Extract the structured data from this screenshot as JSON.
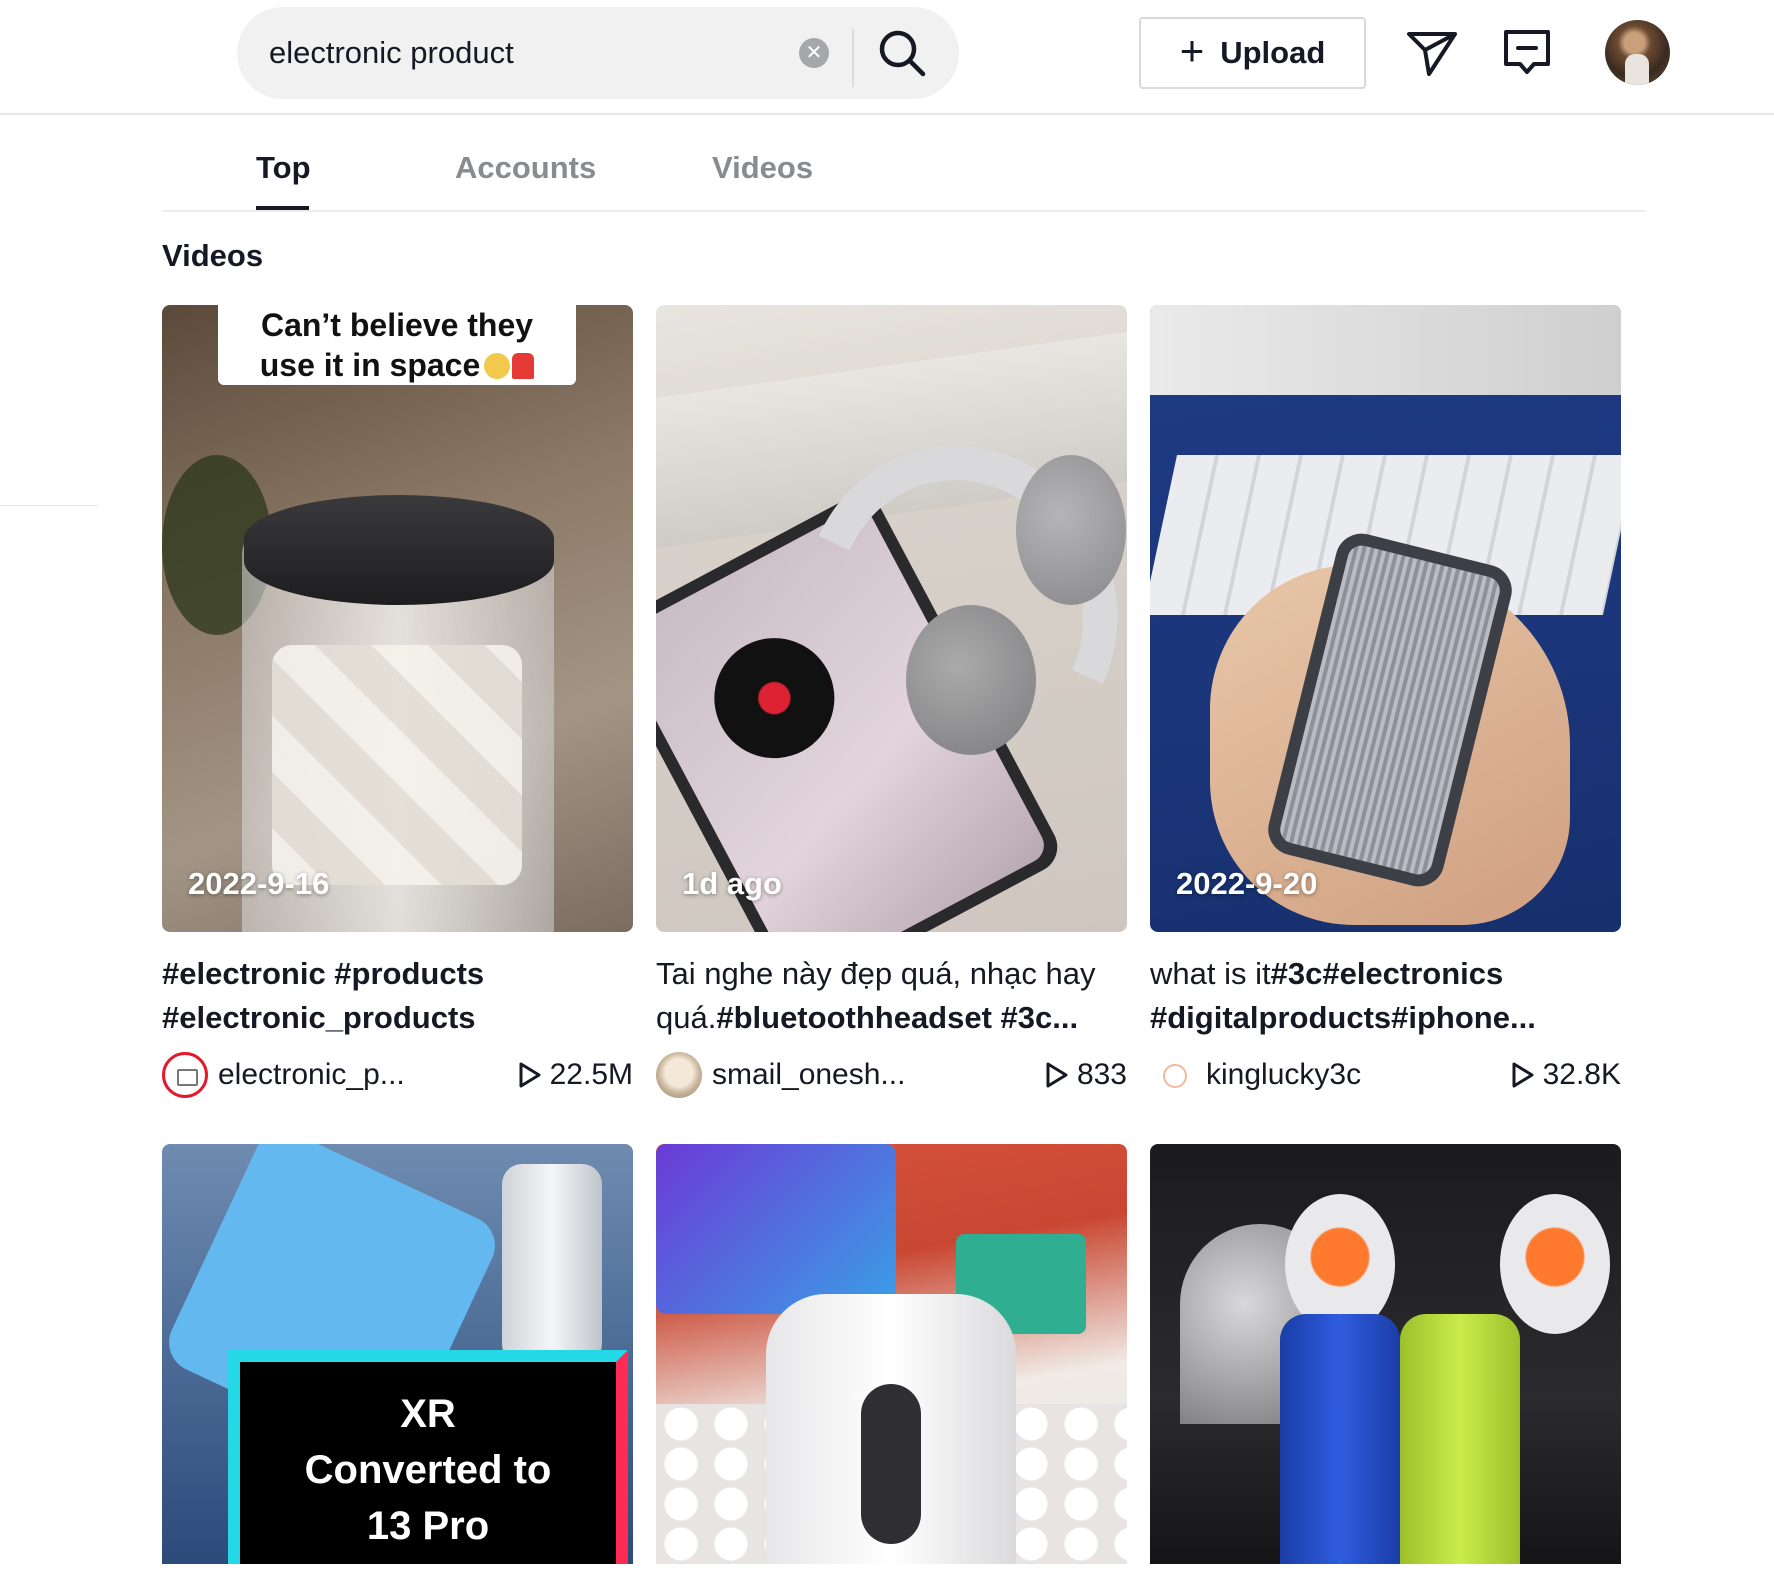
{
  "search": {
    "value": "electronic product",
    "clear_icon": "clear-icon",
    "search_icon": "search-icon"
  },
  "header": {
    "upload_label": "Upload",
    "inbox_icon": "send-icon",
    "messages_icon": "message-icon",
    "avatar_icon": "profile-avatar"
  },
  "tabs": [
    {
      "label": "Top",
      "active": true
    },
    {
      "label": "Accounts",
      "active": false
    },
    {
      "label": "Videos",
      "active": false
    }
  ],
  "section_title": "Videos",
  "videos": [
    {
      "date": "2022-9-16",
      "banner_line1": "Can’t believe they",
      "banner_line2": "use it in space",
      "caption": "#electronic #products #electronic_products",
      "author": "electronic_p...",
      "views": "22.5M"
    },
    {
      "date": "1d ago",
      "caption_plain": "Tai nghe này đẹp quá, nhạc hay quá.",
      "caption_bold": "#bluetoothheadset #3c...",
      "author": "smail_onesh...",
      "views": "833"
    },
    {
      "date": "2022-9-20",
      "caption_plain": "what is it",
      "caption_bold": "#3c#electronics #digitalproducts#iphone...",
      "author": "kinglucky3c",
      "views": "32.8K"
    },
    {
      "overlay_line1": "XR",
      "overlay_line2": "Converted to",
      "overlay_line3": "13 Pro"
    },
    {},
    {}
  ],
  "colors": {
    "text_primary": "#161823",
    "text_secondary": "#8a8b91",
    "tiktok_cyan": "#25d8e6",
    "tiktok_red": "#fe2c55"
  }
}
